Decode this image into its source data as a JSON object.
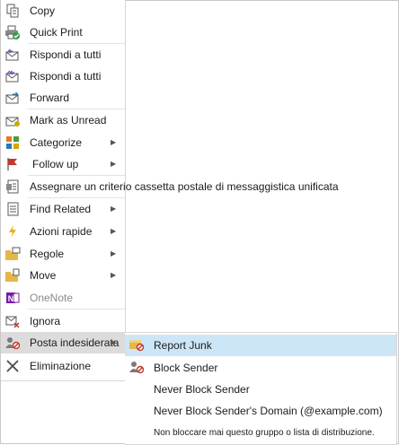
{
  "context_menu": {
    "items": [
      {
        "label": "Copy",
        "icon": "copy-icon"
      },
      {
        "label": "Quick Print",
        "icon": "quick-print-icon"
      },
      {
        "label": "Rispondi a tutti",
        "icon": "reply-icon"
      },
      {
        "label": "Rispondi a tutti",
        "icon": "reply-all-icon"
      },
      {
        "label": "Forward",
        "icon": "forward-icon"
      },
      {
        "label": "Mark as Unread",
        "icon": "mark-unread-icon"
      },
      {
        "label": "Categorize",
        "icon": "categorize-icon",
        "submenu": true
      },
      {
        "label": "Follow up",
        "icon": "flag-icon",
        "submenu": true
      },
      {
        "label": "Assegnare un criterio cassetta postale di messaggistica unificata",
        "icon": "policy-icon"
      },
      {
        "label": "Find Related",
        "icon": "find-related-icon",
        "submenu": true
      },
      {
        "label": "Azioni rapide",
        "icon": "lightning-icon",
        "submenu": true
      },
      {
        "label": "Regole",
        "icon": "rules-icon",
        "submenu": true
      },
      {
        "label": "Move",
        "icon": "move-folder-icon",
        "submenu": true
      },
      {
        "label": "OneNote",
        "icon": "onenote-icon",
        "disabled": true
      },
      {
        "label": "Ignora",
        "icon": "ignore-icon"
      },
      {
        "label": "Posta indesiderata",
        "icon": "junk-icon",
        "submenu": true,
        "active": true
      },
      {
        "label": "Eliminazione",
        "icon": "delete-icon"
      }
    ]
  },
  "junk_submenu": {
    "items": [
      {
        "label": "Report Junk",
        "icon": "report-junk-icon",
        "highlighted": true
      },
      {
        "label": "Block Sender",
        "icon": "block-sender-icon"
      },
      {
        "label": "Never Block Sender",
        "icon": ""
      },
      {
        "label": "Never Block Sender's Domain (@example.com)",
        "icon": ""
      },
      {
        "label": "Non bloccare mai questo gruppo o lista di distribuzione.",
        "icon": ""
      }
    ]
  },
  "colors": {
    "accent": "#cde6f7",
    "flag": "#c0392b",
    "onenote": "#7719aa"
  }
}
